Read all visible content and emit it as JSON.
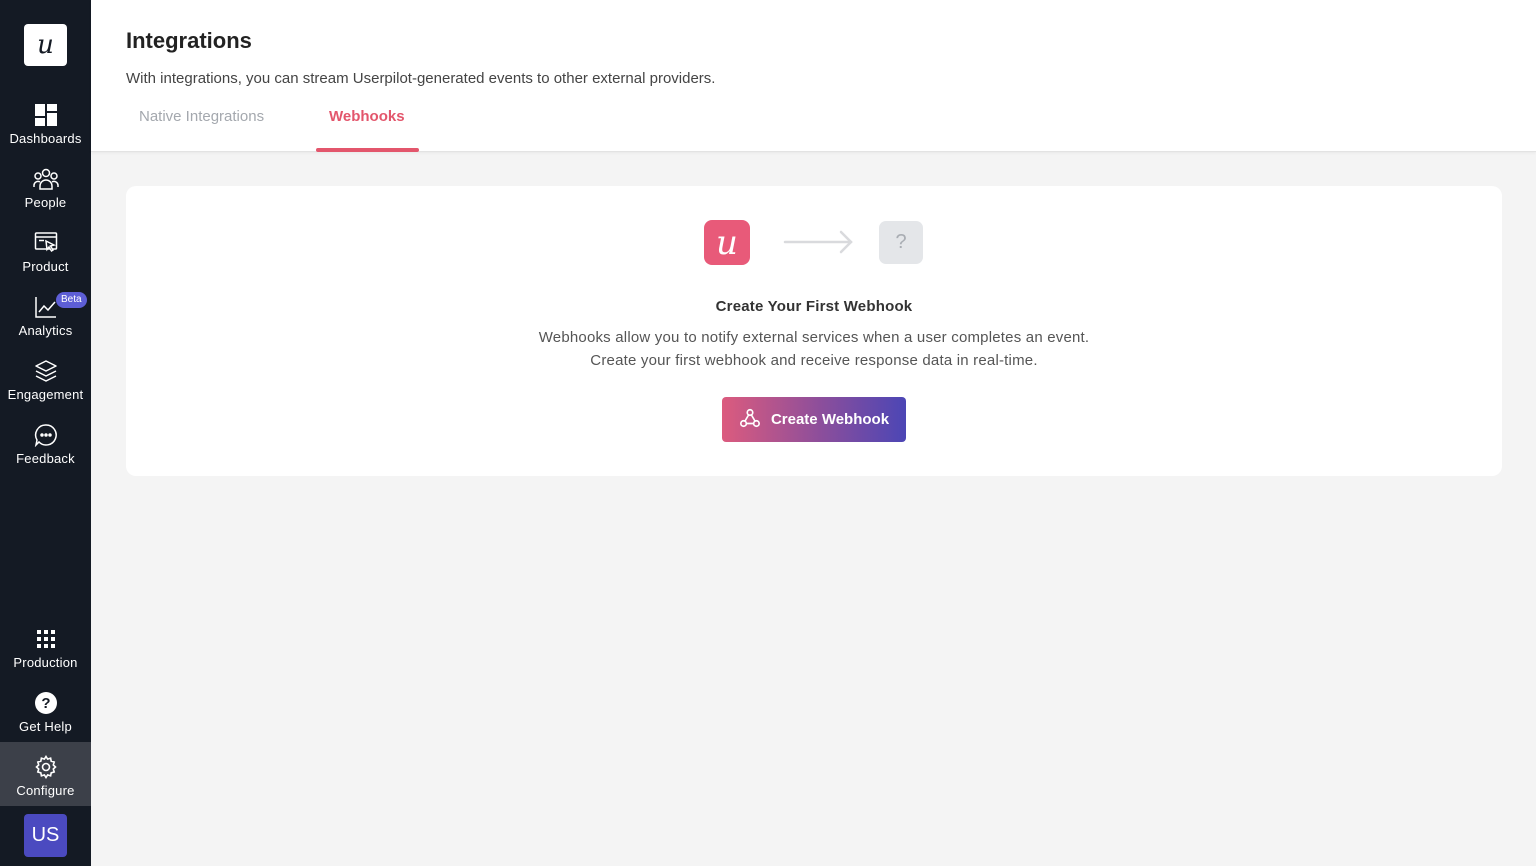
{
  "sidebar": {
    "logo_letter": "u",
    "items": [
      {
        "label": "Dashboards",
        "icon": "dashboard-icon"
      },
      {
        "label": "People",
        "icon": "people-icon"
      },
      {
        "label": "Product",
        "icon": "product-icon"
      },
      {
        "label": "Analytics",
        "icon": "analytics-icon",
        "badge": "Beta"
      },
      {
        "label": "Engagement",
        "icon": "layers-icon"
      },
      {
        "label": "Feedback",
        "icon": "chat-icon"
      }
    ],
    "bottom_items": [
      {
        "label": "Production",
        "icon": "grid-icon"
      },
      {
        "label": "Get Help",
        "icon": "help-icon"
      },
      {
        "label": "Configure",
        "icon": "gear-icon",
        "active": true
      }
    ],
    "avatar": "US"
  },
  "header": {
    "title": "Integrations",
    "subtitle": "With integrations, you can stream Userpilot-generated events to other external providers.",
    "tabs": [
      {
        "label": "Native Integrations",
        "active": false
      },
      {
        "label": "Webhooks",
        "active": true
      }
    ]
  },
  "empty_state": {
    "logo_letter": "u",
    "question_mark": "?",
    "title": "Create Your First Webhook",
    "line1": "Webhooks allow you to notify external services when a user completes an event.",
    "line2": "Create your first webhook and receive response data in real-time.",
    "button_label": "Create Webhook"
  },
  "colors": {
    "sidebar_bg": "#141a24",
    "accent": "#e3566c",
    "badge": "#5d5ed6",
    "avatar": "#4b4ac0"
  }
}
